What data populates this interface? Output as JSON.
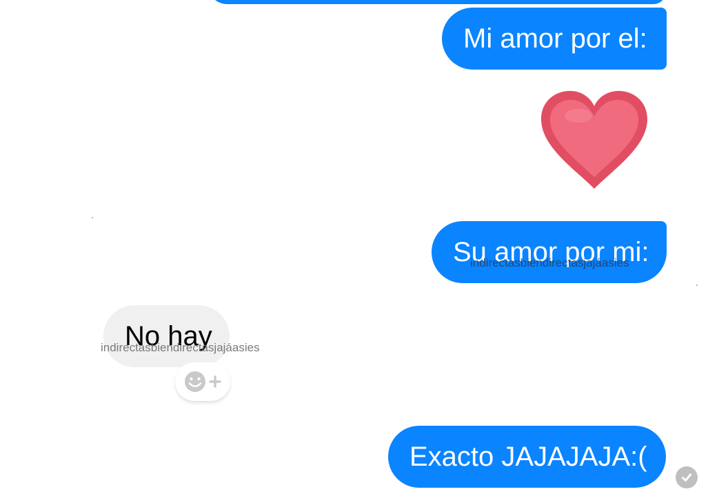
{
  "conversation": {
    "messages": [
      {
        "direction": "outgoing",
        "text": "Mi amor por el:"
      },
      {
        "direction": "outgoing",
        "emoji": "heart-emoji"
      },
      {
        "direction": "outgoing",
        "text": "Su amor por mi:"
      },
      {
        "direction": "incoming",
        "text": "No hay"
      },
      {
        "direction": "outgoing",
        "text": "Exacto JAJAJAJA:("
      }
    ]
  },
  "watermarks": {
    "outgoing": "indirectasbiendirectasjajáasies",
    "incoming": "indirectasbiendirectasjajáasies"
  },
  "icons": {
    "heart": "heart-emoji",
    "reaction": "smiley-add-reaction-icon",
    "seen": "seen-check-icon"
  },
  "colors": {
    "outgoing_bubble": "#0a84ff",
    "incoming_bubble": "#f1f0f0",
    "heart_fill": "#f06b7e",
    "heart_outline": "#e14e63",
    "seen_indicator": "#bfbfbf"
  }
}
